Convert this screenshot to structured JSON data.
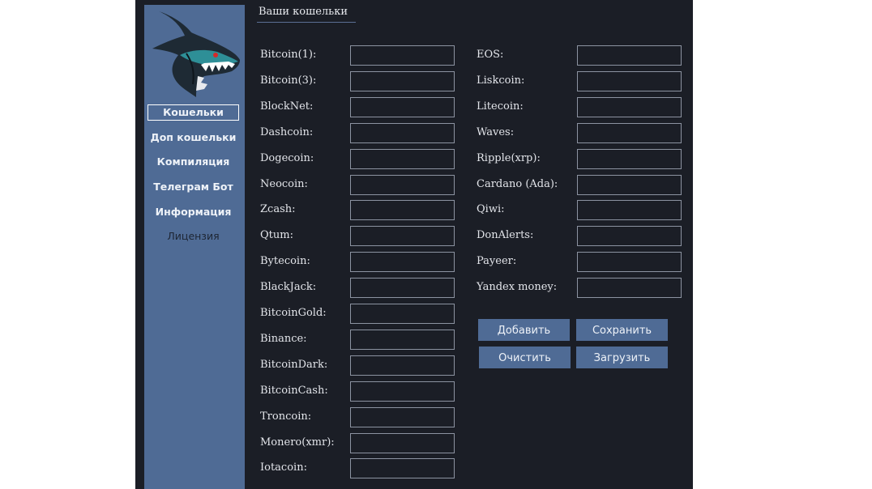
{
  "sidebar": {
    "logo_icon": "shark-logo-icon",
    "items": [
      {
        "label": "Кошельки",
        "active": true
      },
      {
        "label": "Доп кошельки"
      },
      {
        "label": "Компиляция"
      },
      {
        "label": "Телеграм Бот"
      },
      {
        "label": "Информация"
      },
      {
        "label": "Лицензия",
        "dim": true
      }
    ]
  },
  "section": {
    "title": "Ваши кошельки"
  },
  "wallets_left": [
    {
      "label": "Bitcoin(1):",
      "value": ""
    },
    {
      "label": "Bitcoin(3):",
      "value": ""
    },
    {
      "label": "BlockNet:",
      "value": ""
    },
    {
      "label": "Dashcoin:",
      "value": ""
    },
    {
      "label": "Dogecoin:",
      "value": ""
    },
    {
      "label": "Neocoin:",
      "value": ""
    },
    {
      "label": "Zcash:",
      "value": ""
    },
    {
      "label": "Qtum:",
      "value": ""
    },
    {
      "label": "Bytecoin:",
      "value": ""
    },
    {
      "label": "BlackJack:",
      "value": ""
    },
    {
      "label": "BitcoinGold:",
      "value": ""
    },
    {
      "label": "Binance:",
      "value": ""
    },
    {
      "label": "BitcoinDark:",
      "value": ""
    },
    {
      "label": "BitcoinCash:",
      "value": ""
    },
    {
      "label": "Troncoin:",
      "value": ""
    },
    {
      "label": "Monero(xmr):",
      "value": ""
    },
    {
      "label": "Iotacoin:",
      "value": ""
    }
  ],
  "wallets_right": [
    {
      "label": "EOS:",
      "value": ""
    },
    {
      "label": "Liskcoin:",
      "value": ""
    },
    {
      "label": "Litecoin:",
      "value": ""
    },
    {
      "label": "Waves:",
      "value": ""
    },
    {
      "label": "Ripple(xrp):",
      "value": ""
    },
    {
      "label": "Cardano (Ada):",
      "value": ""
    },
    {
      "label": "Qiwi:",
      "value": ""
    },
    {
      "label": "DonAlerts:",
      "value": ""
    },
    {
      "label": "Payeer:",
      "value": ""
    },
    {
      "label": "Yandex money:",
      "value": ""
    }
  ],
  "buttons": {
    "add": "Добавить",
    "save": "Сохранить",
    "clear": "Очистить",
    "load": "Загрузить"
  },
  "colors": {
    "panel": "#1b1e26",
    "sidebar": "#4f6b95",
    "button": "#4f6b95",
    "field_border": "#8c93a1"
  }
}
